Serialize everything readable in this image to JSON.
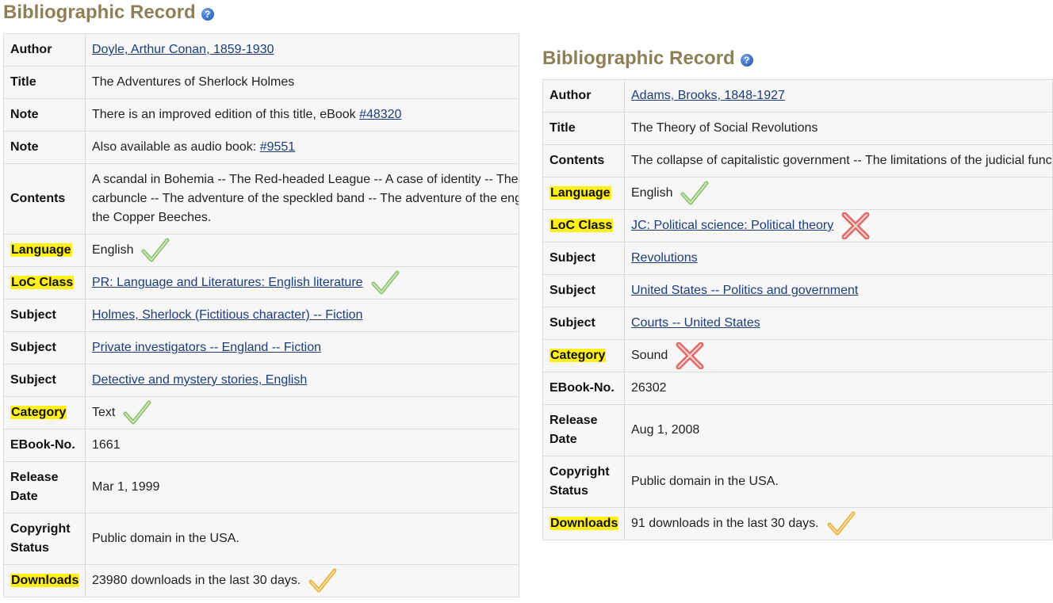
{
  "left": {
    "heading": "Bibliographic Record",
    "rows": {
      "author": {
        "label": "Author",
        "value": "Doyle, Arthur Conan, 1859-1930"
      },
      "title": {
        "label": "Title",
        "value": "The Adventures of Sherlock Holmes"
      },
      "note1": {
        "label": "Note",
        "text": "There is an improved edition of this title, eBook ",
        "link": "#48320"
      },
      "note2": {
        "label": "Note",
        "text": "Also available as audio book: ",
        "link": "#9551"
      },
      "contents": {
        "label": "Contents",
        "value": "A scandal in Bohemia -- The Red-headed League -- A case of identity -- The carbuncle -- The adventure of the speckled band -- The adventure of the eng the Copper Beeches."
      },
      "language": {
        "label": "Language",
        "value": "English",
        "mark": "check-green"
      },
      "loc": {
        "label": "LoC Class",
        "value": "PR: Language and Literatures: English literature",
        "mark": "check-green"
      },
      "subject1": {
        "label": "Subject",
        "value": "Holmes, Sherlock (Fictitious character) -- Fiction"
      },
      "subject2": {
        "label": "Subject",
        "value": "Private investigators -- England -- Fiction"
      },
      "subject3": {
        "label": "Subject",
        "value": "Detective and mystery stories, English"
      },
      "category": {
        "label": "Category",
        "value": "Text",
        "mark": "check-green"
      },
      "ebook": {
        "label": "EBook-No.",
        "value": "1661"
      },
      "release": {
        "label": "Release Date",
        "value": "Mar 1, 1999"
      },
      "copyright": {
        "label": "Copyright Status",
        "value": "Public domain in the USA."
      },
      "downloads": {
        "label": "Downloads",
        "value": "23980 downloads in the last 30 days.",
        "mark": "check-orange"
      }
    }
  },
  "right": {
    "heading": "Bibliographic Record",
    "rows": {
      "author": {
        "label": "Author",
        "value": "Adams, Brooks, 1848-1927"
      },
      "title": {
        "label": "Title",
        "value": "The Theory of Social Revolutions"
      },
      "contents": {
        "label": "Contents",
        "value": "The collapse of capitalistic government -- The limitations of the judicial function"
      },
      "language": {
        "label": "Language",
        "value": "English",
        "mark": "check-green"
      },
      "loc": {
        "label": "LoC Class",
        "value": "JC: Political science: Political theory",
        "mark": "cross-red"
      },
      "subject1": {
        "label": "Subject",
        "value": "Revolutions"
      },
      "subject2": {
        "label": "Subject",
        "value": "United States -- Politics and government"
      },
      "subject3": {
        "label": "Subject",
        "value": "Courts -- United States"
      },
      "category": {
        "label": "Category",
        "value": "Sound",
        "mark": "cross-red"
      },
      "ebook": {
        "label": "EBook-No.",
        "value": "26302"
      },
      "release": {
        "label": "Release Date",
        "value": "Aug 1, 2008"
      },
      "copyright": {
        "label": "Copyright Status",
        "value": "Public domain in the USA."
      },
      "downloads": {
        "label": "Downloads",
        "value": "91 downloads in the last 30 days.",
        "mark": "check-orange"
      }
    }
  },
  "colors": {
    "heading": "#8f7f56",
    "link": "#1c3d7a",
    "highlight": "#ffef1a",
    "check_green": "#7ab857",
    "check_orange": "#e8a31a",
    "cross_red": "#d9534f"
  },
  "icons": [
    "help-icon",
    "check-green-icon",
    "check-orange-icon",
    "cross-red-icon"
  ]
}
